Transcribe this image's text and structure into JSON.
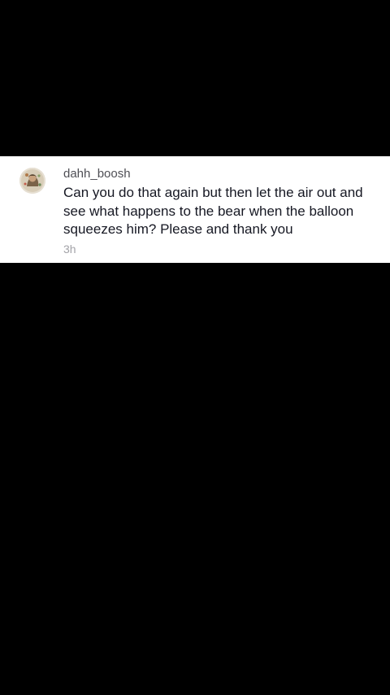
{
  "comment": {
    "username": "dahh_boosh",
    "text": "Can you do that again but then let the air out and see what happens to the bear when the balloon squeezes him? Please and thank you",
    "timestamp": "3h",
    "avatar_icon": "user-avatar"
  },
  "colors": {
    "background": "#000000",
    "card": "#ffffff",
    "username": "#4f4f55",
    "text": "#161823",
    "timestamp": "#a3a3a8"
  }
}
